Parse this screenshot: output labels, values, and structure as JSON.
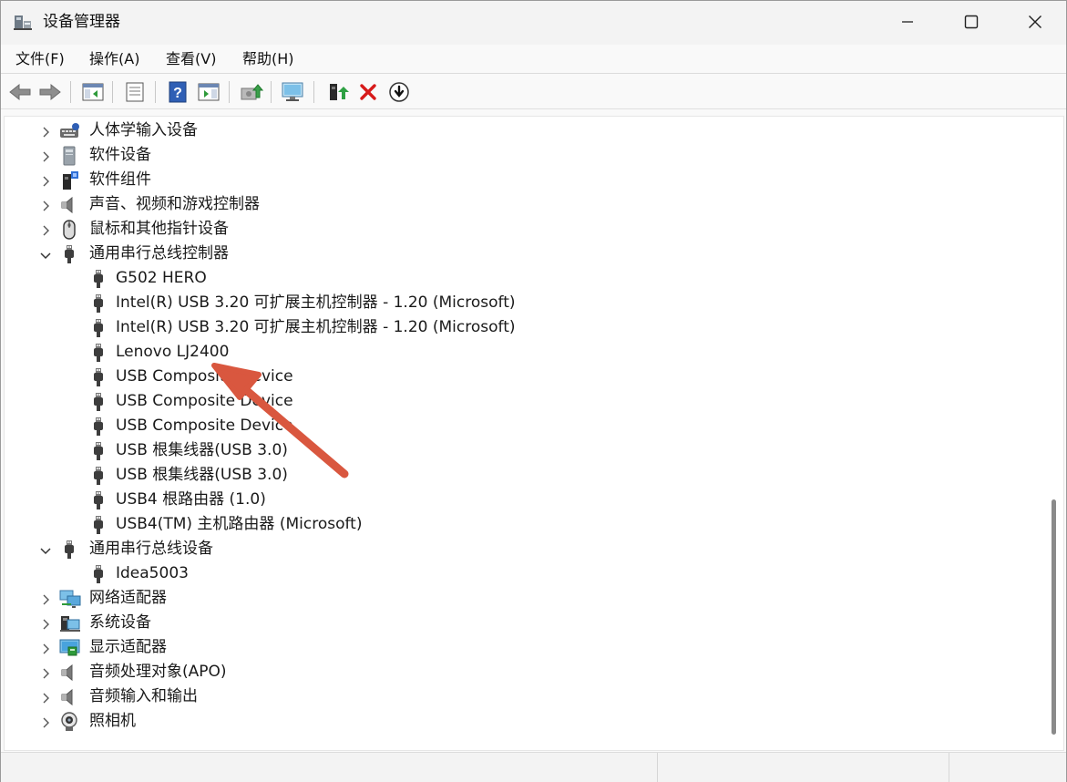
{
  "window": {
    "title": "设备管理器"
  },
  "menubar": {
    "items": [
      "文件(F)",
      "操作(A)",
      "查看(V)",
      "帮助(H)"
    ]
  },
  "toolbar": {
    "buttons": [
      "back-arrow-icon",
      "forward-arrow-icon",
      "show-hide-tree-icon",
      "properties-icon",
      "help-icon",
      "action-pane-icon",
      "update-driver-icon",
      "scan-hardware-icon",
      "enable-device-icon",
      "uninstall-device-icon",
      "disable-device-icon"
    ]
  },
  "tree": {
    "rows": [
      {
        "label": "人体学输入设备",
        "level": 1,
        "expanded": false,
        "icon": "hid-icon"
      },
      {
        "label": "软件设备",
        "level": 1,
        "expanded": false,
        "icon": "software-device-icon"
      },
      {
        "label": "软件组件",
        "level": 1,
        "expanded": false,
        "icon": "software-component-icon"
      },
      {
        "label": "声音、视频和游戏控制器",
        "level": 1,
        "expanded": false,
        "icon": "speaker-icon"
      },
      {
        "label": "鼠标和其他指针设备",
        "level": 1,
        "expanded": false,
        "icon": "mouse-icon"
      },
      {
        "label": "通用串行总线控制器",
        "level": 1,
        "expanded": true,
        "icon": "usb-icon"
      },
      {
        "label": "G502 HERO",
        "level": 2,
        "icon": "usb-icon"
      },
      {
        "label": "Intel(R) USB 3.20 可扩展主机控制器 - 1.20 (Microsoft)",
        "level": 2,
        "icon": "usb-icon"
      },
      {
        "label": "Intel(R) USB 3.20 可扩展主机控制器 - 1.20 (Microsoft)",
        "level": 2,
        "icon": "usb-icon"
      },
      {
        "label": "Lenovo LJ2400",
        "level": 2,
        "icon": "usb-icon"
      },
      {
        "label": "USB Composite Device",
        "level": 2,
        "icon": "usb-icon"
      },
      {
        "label": "USB Composite Device",
        "level": 2,
        "icon": "usb-icon"
      },
      {
        "label": "USB Composite Device",
        "level": 2,
        "icon": "usb-icon"
      },
      {
        "label": "USB 根集线器(USB 3.0)",
        "level": 2,
        "icon": "usb-icon"
      },
      {
        "label": "USB 根集线器(USB 3.0)",
        "level": 2,
        "icon": "usb-icon"
      },
      {
        "label": "USB4 根路由器 (1.0)",
        "level": 2,
        "icon": "usb-icon"
      },
      {
        "label": "USB4(TM) 主机路由器 (Microsoft)",
        "level": 2,
        "icon": "usb-icon"
      },
      {
        "label": "通用串行总线设备",
        "level": 1,
        "expanded": true,
        "icon": "usb-icon"
      },
      {
        "label": "Idea5003",
        "level": 2,
        "icon": "usb-icon"
      },
      {
        "label": "网络适配器",
        "level": 1,
        "expanded": false,
        "icon": "network-adapter-icon"
      },
      {
        "label": "系统设备",
        "level": 1,
        "expanded": false,
        "icon": "system-device-icon"
      },
      {
        "label": "显示适配器",
        "level": 1,
        "expanded": false,
        "icon": "display-adapter-icon"
      },
      {
        "label": "音频处理对象(APO)",
        "level": 1,
        "expanded": false,
        "icon": "speaker-icon"
      },
      {
        "label": "音频输入和输出",
        "level": 1,
        "expanded": false,
        "icon": "speaker-icon"
      },
      {
        "label": "照相机",
        "level": 1,
        "expanded": false,
        "icon": "camera-icon"
      }
    ]
  },
  "colors": {
    "annotation_arrow": "#d9573f",
    "delete_red": "#d71a1a"
  }
}
